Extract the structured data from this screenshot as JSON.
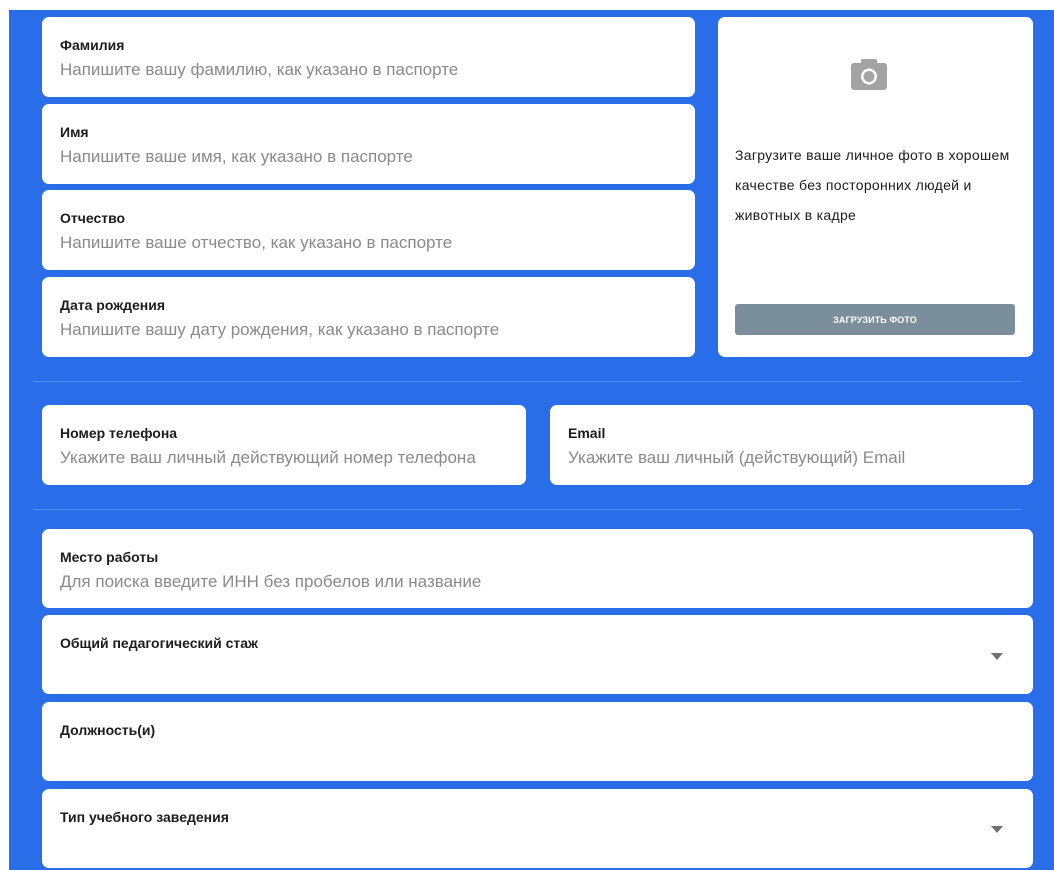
{
  "personal": {
    "last_name": {
      "label": "Фамилия",
      "placeholder": "Напишите вашу фамилию, как указано в паспорте"
    },
    "first_name": {
      "label": "Имя",
      "placeholder": "Напишите ваше имя, как указано в паспорте"
    },
    "patronymic": {
      "label": "Отчество",
      "placeholder": "Напишите ваше отчество, как указано в паспорте"
    },
    "birth_date": {
      "label": "Дата рождения",
      "placeholder": "Напишите вашу дату рождения, как указано в паспорте"
    }
  },
  "photo": {
    "icon": "camera-icon",
    "description": "Загрузите ваше личное фото в хорошем качестве без посторонних людей и животных в кадре",
    "button_label": "ЗАГРУЗИТЬ ФОТО"
  },
  "contacts": {
    "phone": {
      "label": "Номер телефона",
      "placeholder": "Укажите ваш личный действующий номер телефона"
    },
    "email": {
      "label": "Email",
      "placeholder": "Укажите ваш личный (действующий) Email"
    }
  },
  "work": {
    "workplace": {
      "label": "Место работы",
      "placeholder": "Для поиска введите ИНН без пробелов или название"
    },
    "experience": {
      "label": "Общий педагогический стаж",
      "icon": "chevron-down-icon"
    },
    "positions": {
      "label": "Должность(и)"
    },
    "institution_type": {
      "label": "Тип учебного заведения",
      "icon": "chevron-down-icon"
    }
  },
  "colors": {
    "background": "#2a6de8",
    "card": "#ffffff",
    "button": "#7a8f9b",
    "placeholder": "#8a8a8a"
  }
}
